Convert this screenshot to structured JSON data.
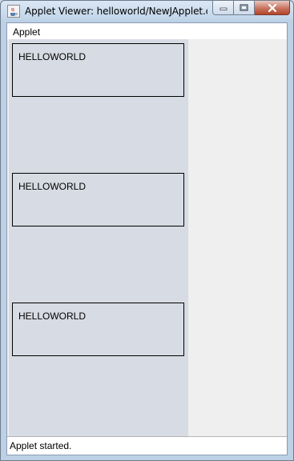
{
  "window": {
    "title": "Applet Viewer: helloworld/NewJApplet.cl...",
    "icon": "java-cup-icon",
    "caption_buttons": [
      "minimize-icon",
      "maximize-icon",
      "close-icon"
    ]
  },
  "menubar": {
    "items": [
      {
        "label": "Applet"
      }
    ]
  },
  "applet": {
    "boxes": [
      {
        "label": "HELLOWORLD"
      },
      {
        "label": "HELLOWORLD"
      },
      {
        "label": "HELLOWORLD"
      }
    ]
  },
  "status": {
    "text": "Applet started."
  },
  "colors": {
    "panel": "#d7dbe3",
    "background": "#efefef",
    "close_button": "#c7745f"
  }
}
